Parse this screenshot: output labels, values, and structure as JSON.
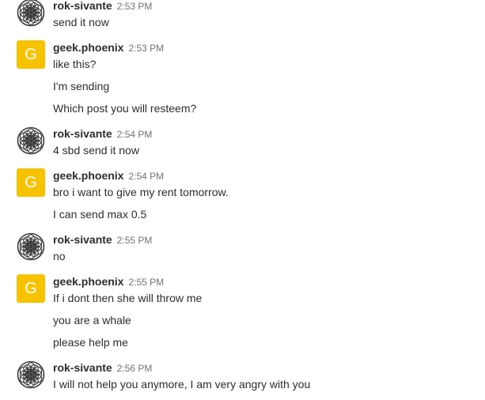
{
  "groups": [
    {
      "username": "rok-sivante",
      "time": "2:53 PM",
      "avatar": "flower-of-life-pattern",
      "messages": [
        "send it now"
      ]
    },
    {
      "username": "geek.phoenix",
      "time": "2:53 PM",
      "avatar_initial": "G",
      "avatar_color": "#f7c200",
      "messages": [
        "like this?",
        "I'm sending",
        "Which post you will resteem?"
      ]
    },
    {
      "username": "rok-sivante",
      "time": "2:54 PM",
      "avatar": "flower-of-life-pattern",
      "messages": [
        "4 sbd send it now"
      ]
    },
    {
      "username": "geek.phoenix",
      "time": "2:54 PM",
      "avatar_initial": "G",
      "avatar_color": "#f7c200",
      "messages": [
        "bro i want to give my rent tomorrow.",
        "I can send max 0.5"
      ]
    },
    {
      "username": "rok-sivante",
      "time": "2:55 PM",
      "avatar": "flower-of-life-pattern",
      "messages": [
        "no"
      ]
    },
    {
      "username": "geek.phoenix",
      "time": "2:55 PM",
      "avatar_initial": "G",
      "avatar_color": "#f7c200",
      "messages": [
        "If i dont then she will throw me",
        "you are a whale",
        "please help me"
      ]
    },
    {
      "username": "rok-sivante",
      "time": "2:56 PM",
      "avatar": "flower-of-life-pattern",
      "messages": [
        "I will not help you anymore, I am very angry with you"
      ]
    }
  ]
}
